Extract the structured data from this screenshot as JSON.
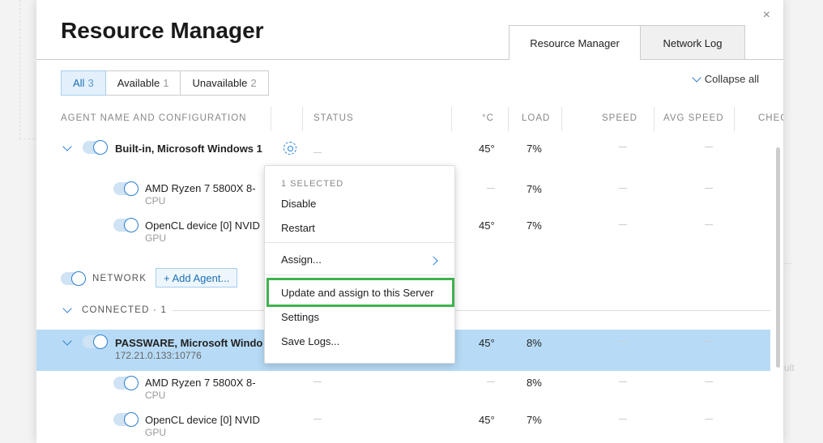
{
  "dialog": {
    "title": "Resource Manager",
    "close_glyph": "×",
    "tabs": [
      {
        "label": "Resource Manager",
        "active": true
      },
      {
        "label": "Network Log",
        "active": false
      }
    ]
  },
  "filters": [
    {
      "label": "All",
      "count": "3",
      "active": true
    },
    {
      "label": "Available",
      "count": "1",
      "active": false
    },
    {
      "label": "Unavailable",
      "count": "2",
      "active": false
    }
  ],
  "collapse_all": "Collapse all",
  "columns": {
    "agent": "AGENT NAME AND CONFIGURATION",
    "status": "STATUS",
    "temp": "°C",
    "load": "LOAD",
    "speed": "SPEED",
    "avg_speed": "AVG SPEED",
    "check": "CHEC"
  },
  "local": {
    "agent_name": "Built-in, Microsoft Windows 1",
    "agent_temp": "45°",
    "agent_load": "7%",
    "devices": [
      {
        "name": "AMD Ryzen 7 5800X 8-",
        "type": "CPU",
        "temp": "",
        "load": "7%"
      },
      {
        "name": "OpenCL device [0] NVID",
        "type": "GPU",
        "temp": "45°",
        "load": "7%"
      }
    ]
  },
  "network": {
    "label": "NETWORK",
    "add_agent": "+ Add Agent..."
  },
  "connected": {
    "label": "CONNECTED · 1",
    "agent_name": "PASSWARE, Microsoft Windo",
    "agent_address": "172.21.0.133:10776",
    "agent_temp": "45°",
    "agent_load": "8%",
    "devices": [
      {
        "name": "AMD Ryzen 7 5800X 8-",
        "type": "CPU",
        "temp": "",
        "load": "8%"
      },
      {
        "name": "OpenCL device [0] NVID",
        "type": "GPU",
        "temp": "45°",
        "load": "7%"
      }
    ]
  },
  "context_menu": {
    "header": "1 SELECTED",
    "items": [
      "Disable",
      "Restart",
      "Assign...",
      "Update and assign to this Server",
      "Settings",
      "Save Logs..."
    ],
    "highlight_color": "#3fb34f"
  },
  "background": {
    "right_texts": [
      "...",
      "ult"
    ]
  },
  "colors": {
    "accent": "#2a7fd1",
    "selected_row": "#b7dbf6"
  }
}
